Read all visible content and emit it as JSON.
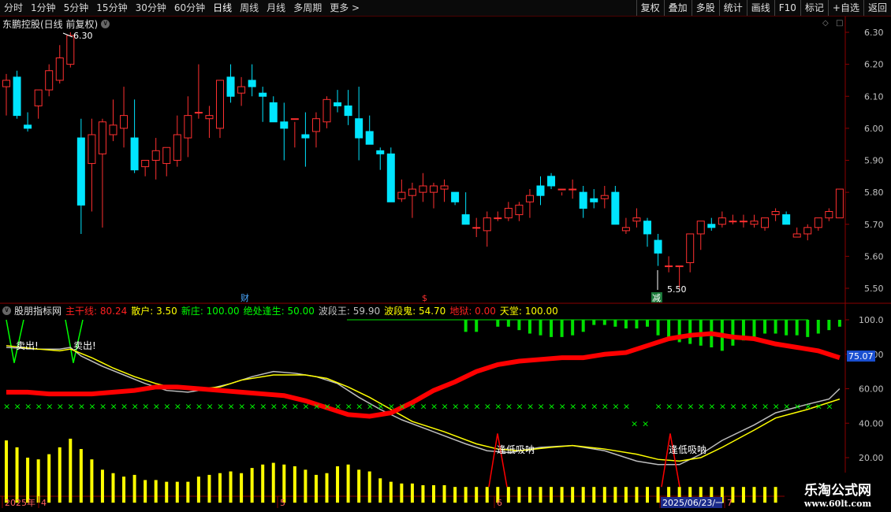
{
  "toolbar": {
    "periods": [
      "分时",
      "1分钟",
      "5分钟",
      "15分钟",
      "30分钟",
      "60分钟",
      "日线",
      "周线",
      "月线",
      "多周期",
      "更多 >"
    ],
    "active_period": "日线",
    "actions": [
      "复权",
      "叠加",
      "多股",
      "统计",
      "画线",
      "F10",
      "标记",
      "+自选",
      "返回"
    ]
  },
  "main_chart": {
    "title": "东鹏控股(日线 前复权)",
    "high_label": "6.30",
    "low_label": "5.50",
    "price_axis": [
      "6.30",
      "6.20",
      "6.10",
      "6.00",
      "5.90",
      "5.80",
      "5.70",
      "5.60",
      "5.50"
    ],
    "markers": [
      {
        "text": "财",
        "color": "#4aa8ff"
      },
      {
        "text": "$",
        "color": "#ff3030"
      },
      {
        "text": "减",
        "color": "#ffffff"
      }
    ],
    "candles": [
      [
        6.13,
        6.17,
        6.04,
        6.15
      ],
      [
        6.16,
        6.18,
        6.03,
        6.04
      ],
      [
        6.01,
        6.05,
        5.99,
        6.0
      ],
      [
        6.07,
        6.12,
        6.03,
        6.12
      ],
      [
        6.12,
        6.2,
        6.1,
        6.18
      ],
      [
        6.15,
        6.26,
        6.14,
        6.22
      ],
      [
        6.2,
        6.3,
        6.19,
        6.29
      ],
      [
        5.97,
        6.03,
        5.67,
        5.76
      ],
      [
        5.89,
        6.03,
        5.74,
        5.98
      ],
      [
        5.92,
        6.03,
        5.69,
        6.02
      ],
      [
        5.98,
        6.09,
        5.96,
        6.01
      ],
      [
        6.0,
        6.13,
        5.94,
        6.04
      ],
      [
        5.97,
        6.09,
        5.86,
        5.87
      ],
      [
        5.88,
        5.9,
        5.85,
        5.9
      ],
      [
        5.9,
        5.97,
        5.84,
        5.93
      ],
      [
        5.89,
        5.94,
        5.85,
        5.94
      ],
      [
        5.9,
        6.04,
        5.88,
        5.98
      ],
      [
        5.97,
        6.1,
        5.91,
        6.04
      ],
      [
        6.05,
        6.2,
        6.03,
        6.05
      ],
      [
        6.03,
        6.07,
        5.97,
        6.04
      ],
      [
        6.0,
        6.11,
        5.97,
        6.15
      ],
      [
        6.16,
        6.2,
        6.08,
        6.1
      ],
      [
        6.11,
        6.16,
        6.07,
        6.13
      ],
      [
        6.15,
        6.2,
        6.1,
        6.13
      ],
      [
        6.11,
        6.13,
        6.02,
        6.1
      ],
      [
        6.08,
        6.1,
        6.02,
        6.02
      ],
      [
        6.02,
        6.08,
        5.9,
        6.0
      ],
      [
        6.03,
        6.02,
        5.94,
        6.03
      ],
      [
        5.98,
        6.05,
        5.88,
        5.97
      ],
      [
        5.99,
        6.05,
        5.94,
        6.03
      ],
      [
        6.02,
        6.1,
        6.0,
        6.09
      ],
      [
        6.08,
        6.12,
        6.05,
        6.07
      ],
      [
        6.07,
        6.12,
        6.01,
        6.04
      ],
      [
        6.03,
        6.13,
        5.9,
        5.97
      ],
      [
        5.99,
        6.04,
        5.96,
        5.95
      ],
      [
        5.93,
        5.94,
        5.87,
        5.92
      ],
      [
        5.92,
        5.94,
        5.87,
        5.77
      ],
      [
        5.78,
        5.84,
        5.77,
        5.8
      ],
      [
        5.79,
        5.83,
        5.72,
        5.81
      ],
      [
        5.8,
        5.86,
        5.77,
        5.82
      ],
      [
        5.8,
        5.83,
        5.75,
        5.82
      ],
      [
        5.81,
        5.84,
        5.77,
        5.82
      ],
      [
        5.8,
        5.8,
        5.76,
        5.77
      ],
      [
        5.73,
        5.8,
        5.73,
        5.7
      ],
      [
        5.69,
        5.72,
        5.66,
        5.69
      ],
      [
        5.68,
        5.74,
        5.63,
        5.72
      ],
      [
        5.72,
        5.74,
        5.71,
        5.72
      ],
      [
        5.72,
        5.77,
        5.71,
        5.75
      ],
      [
        5.73,
        5.77,
        5.71,
        5.76
      ],
      [
        5.77,
        5.81,
        5.72,
        5.79
      ],
      [
        5.82,
        5.85,
        5.76,
        5.79
      ],
      [
        5.85,
        5.86,
        5.81,
        5.82
      ],
      [
        5.81,
        5.8,
        5.79,
        5.81
      ],
      [
        5.81,
        5.84,
        5.78,
        5.81
      ],
      [
        5.8,
        5.82,
        5.72,
        5.75
      ],
      [
        5.78,
        5.81,
        5.75,
        5.77
      ],
      [
        5.78,
        5.82,
        5.75,
        5.79
      ],
      [
        5.8,
        5.82,
        5.71,
        5.7
      ],
      [
        5.68,
        5.72,
        5.67,
        5.69
      ],
      [
        5.71,
        5.75,
        5.69,
        5.72
      ],
      [
        5.71,
        5.72,
        5.63,
        5.67
      ],
      [
        5.65,
        5.67,
        5.57,
        5.61
      ],
      [
        5.57,
        5.6,
        5.55,
        5.57
      ],
      [
        5.57,
        5.57,
        5.5,
        5.57
      ],
      [
        5.58,
        5.63,
        5.55,
        5.67
      ],
      [
        5.67,
        5.71,
        5.62,
        5.71
      ],
      [
        5.7,
        5.72,
        5.68,
        5.69
      ],
      [
        5.7,
        5.74,
        5.69,
        5.72
      ],
      [
        5.71,
        5.73,
        5.7,
        5.71
      ],
      [
        5.71,
        5.73,
        5.69,
        5.71
      ],
      [
        5.7,
        5.73,
        5.69,
        5.71
      ],
      [
        5.69,
        5.72,
        5.68,
        5.72
      ],
      [
        5.73,
        5.75,
        5.71,
        5.74
      ],
      [
        5.73,
        5.74,
        5.72,
        5.7
      ],
      [
        5.66,
        5.69,
        5.67,
        5.67
      ],
      [
        5.67,
        5.7,
        5.65,
        5.69
      ],
      [
        5.69,
        5.72,
        5.68,
        5.72
      ],
      [
        5.72,
        5.75,
        5.71,
        5.74
      ],
      [
        5.72,
        5.78,
        5.72,
        5.81
      ]
    ]
  },
  "indicator": {
    "name": "股朋指标网",
    "values": [
      {
        "label": "主干线",
        "value": "80.24",
        "color": "#ff2020"
      },
      {
        "label": "散户",
        "value": "3.50",
        "color": "#ffff00"
      },
      {
        "label": "新庄",
        "value": "100.00",
        "color": "#00ff00"
      },
      {
        "label": "绝处逢生",
        "value": "50.00",
        "color": "#00ff00"
      },
      {
        "label": "波段王",
        "value": "59.90",
        "color": "#c0c0c0"
      },
      {
        "label": "波段鬼",
        "value": "54.70",
        "color": "#ffff00"
      },
      {
        "label": "地狱",
        "value": "0.00",
        "color": "#ff2020"
      },
      {
        "label": "天堂",
        "value": "100.00",
        "color": "#ffff00"
      }
    ],
    "axis": [
      "100.0",
      "80.00",
      "60.00",
      "40.00",
      "20.00"
    ],
    "current_value": "75.07",
    "annotations": [
      "卖出!",
      "卖出!",
      "逢低吸呐",
      "逢低吸呐"
    ]
  },
  "date_axis": {
    "labels": [
      "2025年",
      "4",
      "5",
      "6",
      "2025/06/23/一",
      "7"
    ]
  },
  "watermark": {
    "title": "乐淘公式网",
    "url": "www.60lt.com"
  },
  "colors": {
    "up": "#ff3030",
    "down": "#00e5ff",
    "grid": "#6a0000",
    "axis_text": "#c0c0c0"
  }
}
